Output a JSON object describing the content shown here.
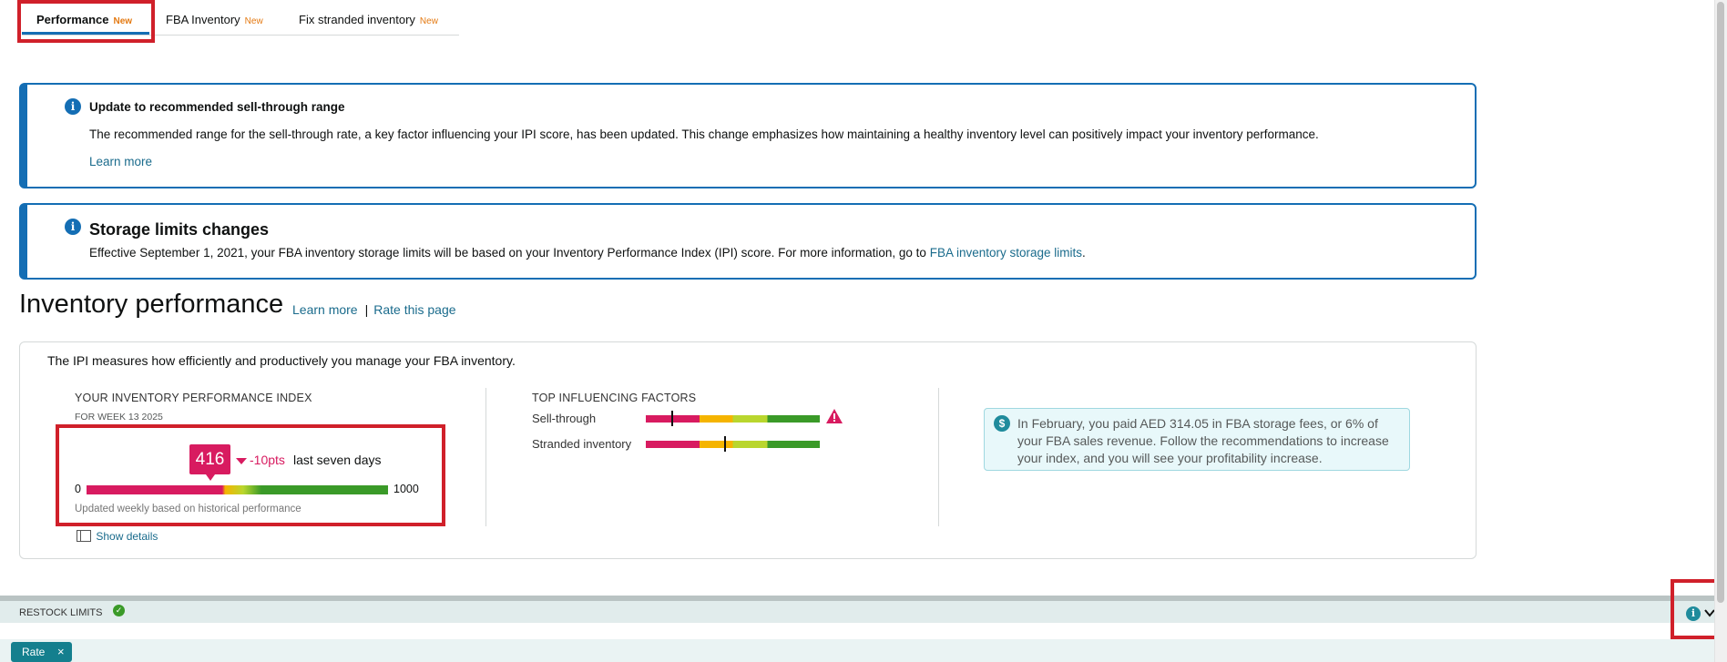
{
  "tabs": [
    {
      "label": "Performance",
      "badge": "New"
    },
    {
      "label": "FBA Inventory",
      "badge": "New"
    },
    {
      "label": "Fix stranded inventory",
      "badge": "New"
    }
  ],
  "banner1": {
    "title": "Update to recommended sell-through range",
    "text": "The recommended range for the sell-through rate, a key factor influencing your IPI score, has been updated. This change emphasizes how maintaining a healthy inventory level can positively impact your inventory performance.",
    "link": "Learn more"
  },
  "banner2": {
    "title": "Storage limits changes",
    "text": "Effective September 1, 2021, your FBA inventory storage limits will be based on your Inventory Performance Index (IPI) score. For more information, go to",
    "link": "FBA inventory storage limits",
    "period": "."
  },
  "heading": {
    "title": "Inventory performance",
    "learn_more": "Learn more",
    "separator": "|",
    "rate_page": "Rate this page"
  },
  "card": {
    "intro": "The IPI measures how efficiently and productively you manage your FBA inventory.",
    "ipi": {
      "title": "YOUR INVENTORY PERFORMANCE INDEX",
      "week": "FOR WEEK 13 2025",
      "score": "416",
      "score_value": 416,
      "min": "0",
      "max": "1000",
      "change": "-10pts",
      "period": "last seven days",
      "note": "Updated weekly based on historical performance",
      "show_details": "Show details"
    },
    "factors": {
      "title": "TOP INFLUENCING FACTORS",
      "items": [
        {
          "label": "Sell-through",
          "marker_fraction": 0.16,
          "warning": true
        },
        {
          "label": "Stranded inventory",
          "marker_fraction": 0.46,
          "warning": false
        }
      ]
    },
    "callout": {
      "text": "In February, you paid AED 314.05 in FBA storage fees, or 6% of your FBA sales revenue. Follow the recommendations to increase your index, and you will see your profitability increase."
    }
  },
  "restock": {
    "label": "RESTOCK LIMITS"
  },
  "rate_button": {
    "label": "Rate",
    "close": "×"
  },
  "icons": {
    "info": "info-icon",
    "check": "check-icon",
    "chevron": "chevron-down-icon",
    "warning": "warning-icon",
    "dollar": "dollar-icon"
  },
  "colors": {
    "accent": "#146eb4",
    "link": "#1a6b8c",
    "red": "#d81b60",
    "green": "#3a9a28",
    "yellow": "#f5b400",
    "teal": "#147f8e"
  }
}
